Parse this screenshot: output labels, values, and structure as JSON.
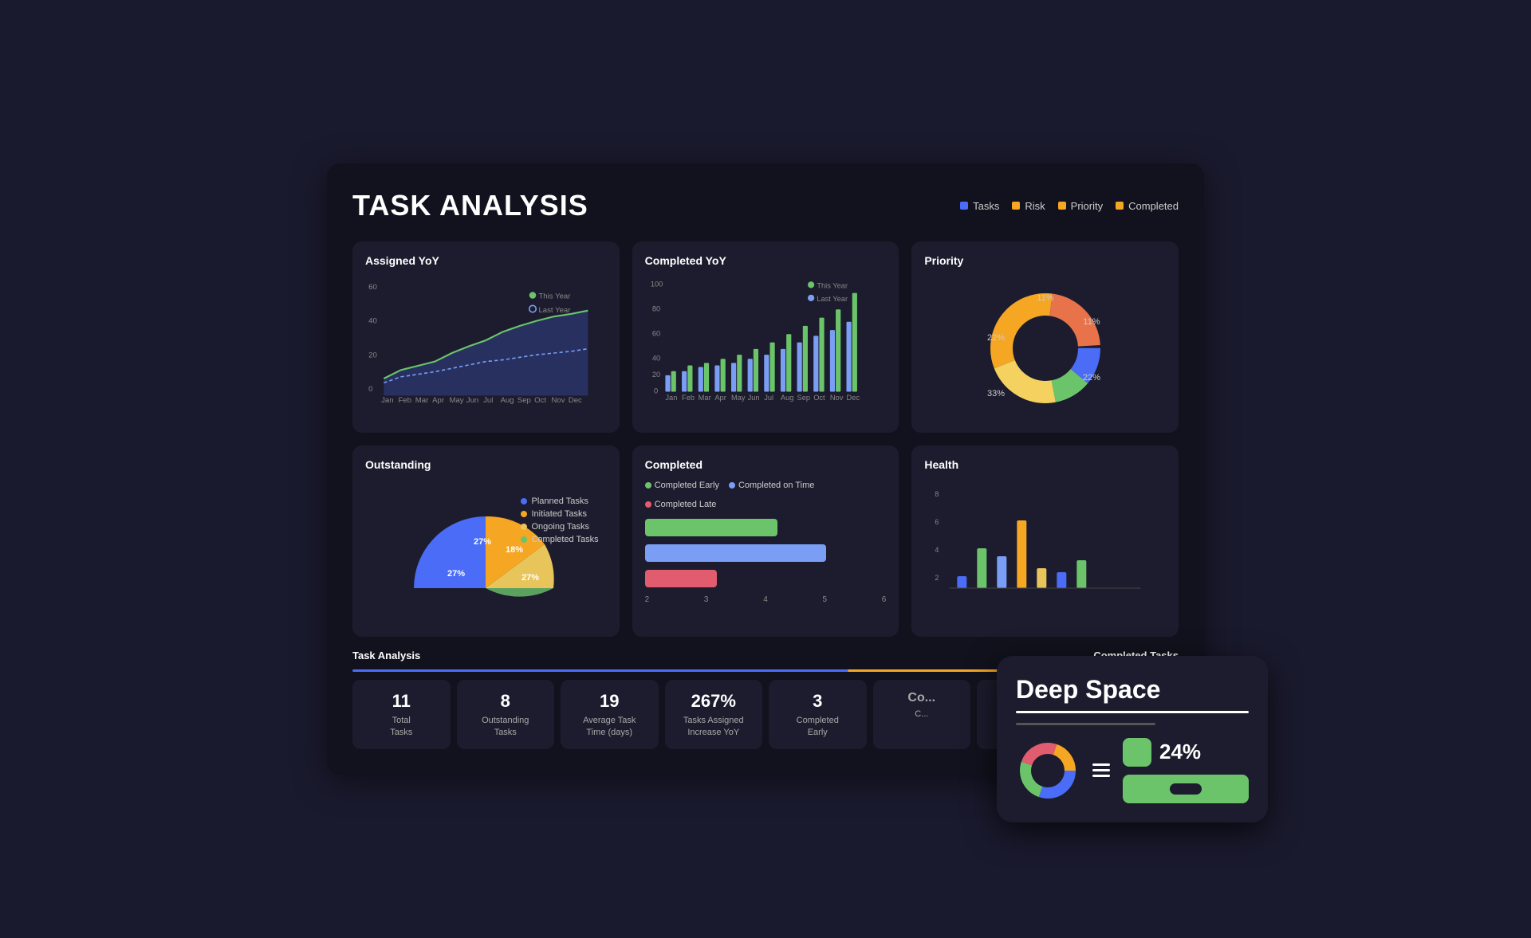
{
  "header": {
    "title": "TASK ANALYSIS",
    "legend": [
      {
        "label": "Tasks",
        "color": "#4a6cf7"
      },
      {
        "label": "Risk",
        "color": "#f5a623"
      },
      {
        "label": "Priority",
        "color": "#f5a623"
      },
      {
        "label": "Completed",
        "color": "#f5a623"
      }
    ]
  },
  "cards": {
    "assigned_yoy": {
      "title": "Assigned YoY",
      "legend_this_year": "This Year",
      "legend_last_year": "Last Year",
      "y_max": 60,
      "months": [
        "Jan",
        "Feb",
        "Mar",
        "Apr",
        "May",
        "Jun",
        "Jul",
        "Aug",
        "Sep",
        "Oct",
        "Nov",
        "Dec"
      ]
    },
    "completed_yoy": {
      "title": "Completed YoY",
      "legend_this_year": "This Year",
      "legend_last_year": "Last Year",
      "y_max": 100,
      "months": [
        "Jan",
        "Feb",
        "Mar",
        "Apr",
        "May",
        "Jun",
        "Jul",
        "Aug",
        "Sep",
        "Oct",
        "Nov",
        "Dec"
      ]
    },
    "priority": {
      "title": "Priority",
      "segments": [
        {
          "label": "11%",
          "value": 11,
          "color": "#4a6cf7"
        },
        {
          "label": "11%",
          "value": 11,
          "color": "#6bc46a"
        },
        {
          "label": "22%",
          "value": 22,
          "color": "#f5a623"
        },
        {
          "label": "33%",
          "value": 33,
          "color": "#f5a623"
        },
        {
          "label": "22%",
          "value": 22,
          "color": "#e8734a"
        }
      ]
    },
    "outstanding": {
      "title": "Outstanding",
      "legend": [
        {
          "label": "Planned Tasks",
          "color": "#4a6cf7"
        },
        {
          "label": "Initiated Tasks",
          "color": "#f5a623"
        },
        {
          "label": "Ongoing Tasks",
          "color": "#e8c55a"
        },
        {
          "label": "Completed Tasks",
          "color": "#6bc46a"
        }
      ],
      "segments": [
        {
          "value": 27,
          "color": "#4a6cf7"
        },
        {
          "value": 27,
          "color": "#f5a623"
        },
        {
          "value": 27,
          "color": "#e8c55a"
        },
        {
          "value": 18,
          "color": "#6bc46a"
        }
      ],
      "labels": [
        "27%",
        "27%",
        "18%",
        "27%"
      ]
    },
    "completed": {
      "title": "Completed",
      "legend": [
        {
          "label": "Completed Early",
          "color": "#6bc46a"
        },
        {
          "label": "Completed on Time",
          "color": "#7b9ef5"
        },
        {
          "label": "Completed Late",
          "color": "#e05c6e"
        }
      ],
      "bars": [
        {
          "color": "#6bc46a",
          "width_pct": 55
        },
        {
          "color": "#7b9ef5",
          "width_pct": 75
        },
        {
          "color": "#e05c6e",
          "width_pct": 30
        }
      ],
      "x_labels": [
        "2",
        "3",
        "4",
        "5",
        "6"
      ]
    },
    "health": {
      "title": "Health",
      "y_labels": [
        "8",
        "6",
        "4",
        "2"
      ],
      "bars_colors": [
        "#4a6cf7",
        "#6bc46a",
        "#7b9ef5",
        "#f5a623",
        "#e8c55a"
      ]
    }
  },
  "stats": {
    "task_analysis_label": "Task Analysis",
    "completed_tasks_label": "Completed Tasks",
    "items": [
      {
        "value": "11",
        "desc": "Total\nTasks"
      },
      {
        "value": "8",
        "desc": "Outstanding\nTasks"
      },
      {
        "value": "19",
        "desc": "Average Task\nTime (days)"
      },
      {
        "value": "267%",
        "desc": "Tasks Assigned\nIncrease YoY"
      },
      {
        "value": "3",
        "desc": "Completed\nEarly"
      },
      {
        "value": "Co...",
        "desc": "C..."
      },
      {
        "value": "",
        "desc": ""
      },
      {
        "value": "",
        "desc": ""
      }
    ]
  },
  "deep_space": {
    "title": "Deep Space",
    "percent": "24%",
    "donut_segments": [
      {
        "value": 30,
        "color": "#4a6cf7"
      },
      {
        "value": 25,
        "color": "#6bc46a"
      },
      {
        "value": 25,
        "color": "#e05c6e"
      },
      {
        "value": 20,
        "color": "#f5a623"
      }
    ]
  }
}
